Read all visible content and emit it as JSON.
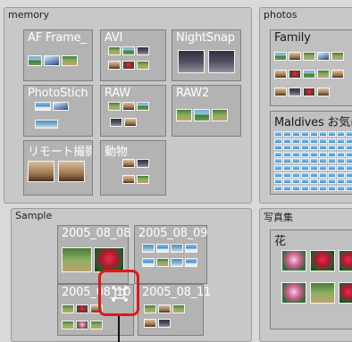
{
  "groups": {
    "memory": {
      "title": "memory"
    },
    "photos": {
      "title": "photos"
    },
    "sample": {
      "title": "Sample"
    },
    "photobook": {
      "title": "写真集"
    }
  },
  "folders": {
    "af_frame": "AF Frame_",
    "avi": "AVI",
    "nightsnap": "NightSnap",
    "photostich": "PhotoStich",
    "raw": "RAW",
    "raw2": "RAW2",
    "remote": "リモート撮影",
    "animals": "動物",
    "family": "Family",
    "maldives": "Maldives お気に",
    "d0808": "2005_08_08",
    "d0809": "2005_08_09",
    "d0810": "2005_08_10",
    "d0811": "2005_08_11",
    "flowers": "花"
  },
  "icons": {
    "zoom_icon": "zoom-icon"
  },
  "colors": {
    "selection": "#e01818"
  }
}
